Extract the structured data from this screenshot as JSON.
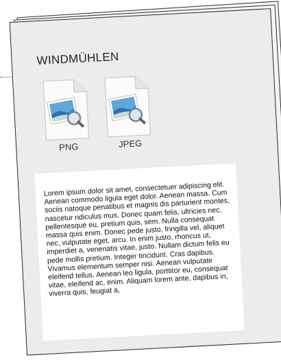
{
  "document": {
    "title": "WINDMÜHLEN",
    "files": [
      {
        "label": "PNG",
        "icon": "image-file-icon"
      },
      {
        "label": "JPEG",
        "icon": "image-file-icon"
      }
    ],
    "body_text": "Lorem ipsum dolor sit amet, consectetuer adipiscing elit. Aenean commodo ligula eget dolor. Aenean massa. Cum sociis natoque penatibus et magnis dis parturient montes, nascetur ridiculus mus. Donec quam felis, ultricies nec, pellentesque eu, pretium quis, sem. Nulla consequat massa quis enim. Donec pede justo, fringilla vel, aliquet nec, vulputate eget, arcu. In enim justo, rhoncus ut, imperdiet a, venenatis vitae, justo. Nullam dictum felis eu pede mollis pretium. Integer tincidunt. Cras dapibus. Vivamus elementum semper nisi. Aenean vulputate eleifend tellus. Aenean leo ligula, porttitor eu, consequat vitae, eleifend ac, enim. Aliquam lorem ante, dapibus in, viverra quis, feugiat a,"
  }
}
